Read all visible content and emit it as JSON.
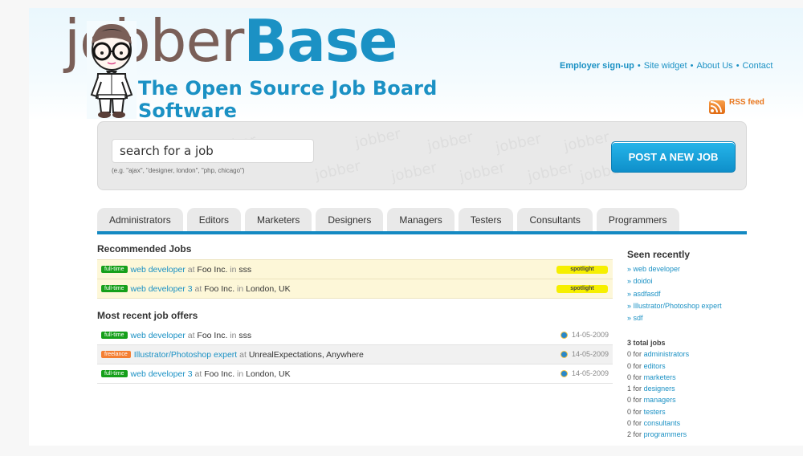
{
  "logo": {
    "name_part1": "jobber",
    "name_part2": "Base",
    "tagline": "The Open Source Job Board Software"
  },
  "topnav": {
    "items": [
      "Employer sign-up",
      "Site widget",
      "About Us",
      "Contact"
    ],
    "separator": "•"
  },
  "rss": {
    "label": "RSS feed"
  },
  "search": {
    "placeholder": "search for a job",
    "value": "search for a job",
    "hint": "(e.g. \"ajax\", \"designer, london\", \"php, chicago\")",
    "watermark": "jobber"
  },
  "post_button": {
    "label": "POST A NEW JOB"
  },
  "tabs": [
    "Administrators",
    "Editors",
    "Marketers",
    "Designers",
    "Managers",
    "Testers",
    "Consultants",
    "Programmers"
  ],
  "recommended": {
    "title": "Recommended Jobs",
    "jobs": [
      {
        "type": "full-time",
        "title": "web developer",
        "at": "at",
        "company": "Foo Inc.",
        "in": "in",
        "location": "sss",
        "flag": "spotlight"
      },
      {
        "type": "full-time",
        "title": "web developer 3",
        "at": "at",
        "company": "Foo Inc.",
        "in": "in",
        "location": "London, UK",
        "flag": "spotlight"
      }
    ]
  },
  "recent": {
    "title": "Most recent job offers",
    "jobs": [
      {
        "type": "full-time",
        "title": "web developer",
        "at": "at",
        "company": "Foo Inc.",
        "in": "in",
        "location": "sss",
        "date": "14-05-2009"
      },
      {
        "type": "freelance",
        "title": "Illustrator/Photoshop expert",
        "at": "at",
        "company": "UnrealExpectations, Anywhere",
        "in": "",
        "location": "",
        "date": "14-05-2009"
      },
      {
        "type": "full-time",
        "title": "web developer 3",
        "at": "at",
        "company": "Foo Inc.",
        "in": "in",
        "location": "London, UK",
        "date": "14-05-2009"
      }
    ]
  },
  "sidebar": {
    "seen_title": "Seen recently",
    "seen_items": [
      "» web developer",
      "» doidoi",
      "» asdfasdf",
      "» Illustrator/Photoshop expert",
      "» sdf"
    ],
    "stats_title": "3 total jobs",
    "stats": [
      {
        "count": "0",
        "for": "for",
        "category": "administrators"
      },
      {
        "count": "0",
        "for": "for",
        "category": "editors"
      },
      {
        "count": "0",
        "for": "for",
        "category": "marketers"
      },
      {
        "count": "1",
        "for": "for",
        "category": "designers"
      },
      {
        "count": "0",
        "for": "for",
        "category": "managers"
      },
      {
        "count": "0",
        "for": "for",
        "category": "testers"
      },
      {
        "count": "0",
        "for": "for",
        "category": "consultants"
      },
      {
        "count": "2",
        "for": "for",
        "category": "programmers"
      }
    ]
  },
  "colors": {
    "brand_blue": "#1b91c4",
    "brand_brown": "#7a5f58",
    "fulltime_badge": "#16a01a",
    "freelance_badge": "#f47f33",
    "spotlight": "#f6ef00",
    "rss_orange": "#e8761d"
  }
}
